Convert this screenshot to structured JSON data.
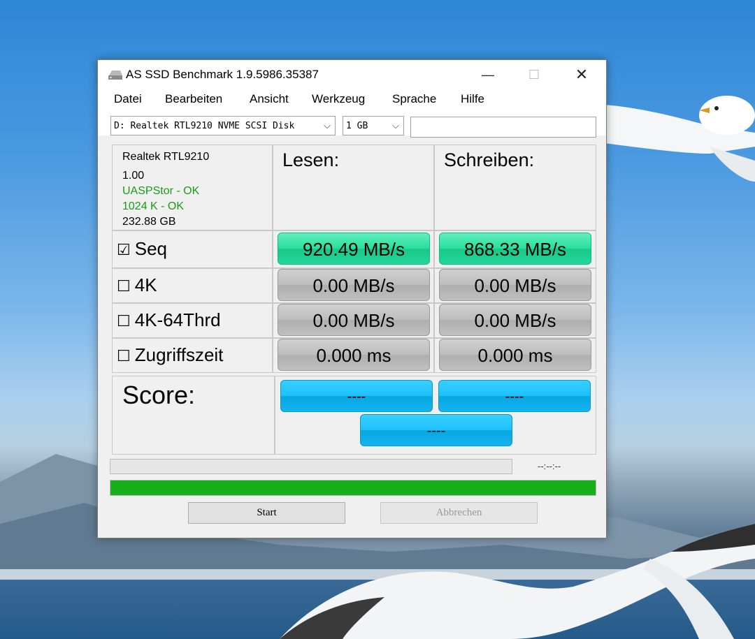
{
  "window": {
    "title": "AS SSD Benchmark 1.9.5986.35387",
    "controls": {
      "minimize": "—",
      "maximize": "☐",
      "close": "✕"
    }
  },
  "menu": [
    "Datei",
    "Bearbeiten",
    "Ansicht",
    "Werkzeug",
    "Sprache",
    "Hilfe"
  ],
  "toolbar": {
    "drive_select": "D: Realtek RTL9210 NVME SCSI Disk",
    "size_select": "1 GB",
    "text_field": ""
  },
  "drive_info": {
    "name": "Realtek RTL9210",
    "firmware": "1.00",
    "driver_status": "UASPStor - OK",
    "alignment_status": "1024 K - OK",
    "capacity": "232.88 GB"
  },
  "columns": {
    "read": "Lesen:",
    "write": "Schreiben:"
  },
  "tests": [
    {
      "label": "Seq",
      "checked": true,
      "checkbox": "☑",
      "read": "920.49 MB/s",
      "write": "868.33 MB/s"
    },
    {
      "label": "4K",
      "checked": false,
      "checkbox": "☐",
      "read": "0.00 MB/s",
      "write": "0.00 MB/s"
    },
    {
      "label": "4K-64Thrd",
      "checked": false,
      "checkbox": "☐",
      "read": "0.00 MB/s",
      "write": "0.00 MB/s"
    },
    {
      "label": "Zugriffszeit",
      "checked": false,
      "checkbox": "☐",
      "read": "0.000 ms",
      "write": "0.000 ms"
    }
  ],
  "score": {
    "label": "Score:",
    "read": "----",
    "write": "----",
    "total": "----"
  },
  "progress": {
    "time": "--:--:--",
    "task_fraction": 0,
    "overall_fraction": 1
  },
  "buttons": {
    "start": "Start",
    "cancel": "Abbrechen"
  },
  "colors": {
    "result_done": "#28de9a",
    "result_idle": "#bdbdbd",
    "score": "#1ec0fb",
    "progress": "#17b01c"
  },
  "icons": {
    "app": "hard-drive-icon",
    "dropdown": "chevron-down-icon"
  }
}
